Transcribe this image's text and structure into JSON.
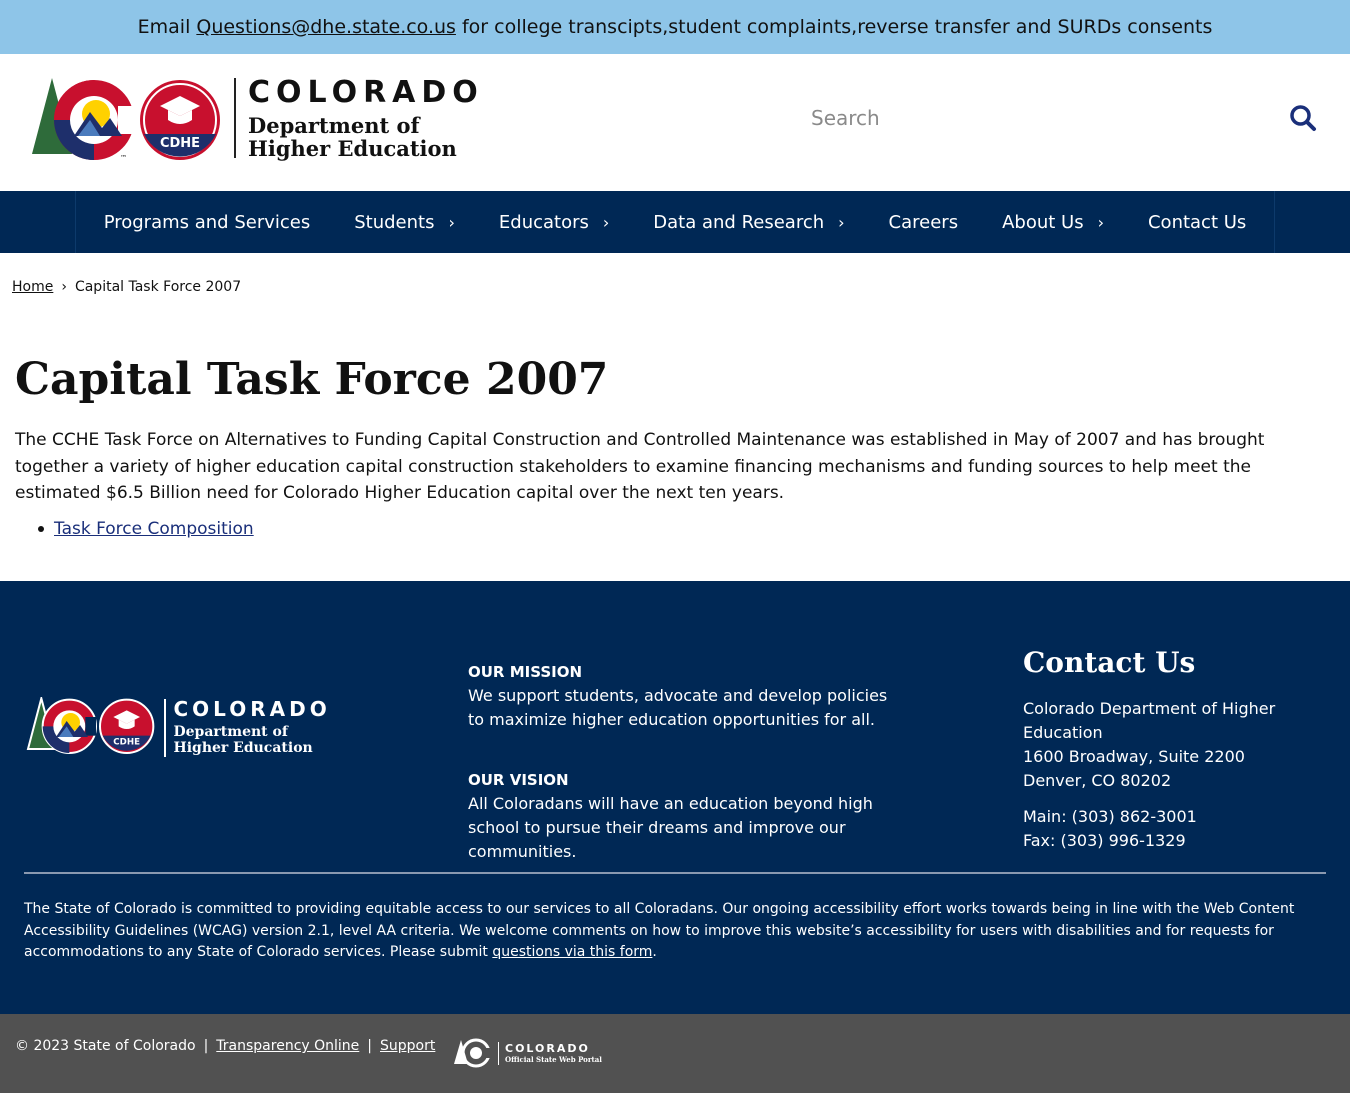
{
  "alert": {
    "prefix": "Email",
    "email": "Questions@dhe.state.co.us",
    "suffix": "for college transcipts,student complaints,reverse transfer and SURDs consents"
  },
  "header": {
    "logo_title": "COLORADO",
    "logo_sub_line1": "Department of",
    "logo_sub_line2": "Higher Education",
    "badge_text": "CDHE",
    "tm_mark": "™",
    "search_placeholder": "Search",
    "search_icon": "search-icon"
  },
  "nav": {
    "items": [
      {
        "label": "Programs and Services",
        "has_submenu": false
      },
      {
        "label": "Students",
        "has_submenu": true
      },
      {
        "label": "Educators",
        "has_submenu": true
      },
      {
        "label": "Data and Research",
        "has_submenu": true
      },
      {
        "label": "Careers",
        "has_submenu": false
      },
      {
        "label": "About Us",
        "has_submenu": true
      },
      {
        "label": "Contact Us",
        "has_submenu": false
      }
    ],
    "caret": "›"
  },
  "breadcrumb": {
    "home": "Home",
    "separator": "›",
    "current": "Capital Task Force 2007"
  },
  "main": {
    "title": "Capital Task Force 2007",
    "intro": "The CCHE Task Force on Alternatives to Funding Capital Construction and Controlled Maintenance was established in May of 2007 and has brought together a variety of higher education capital construction stakeholders to examine financing mechanisms and funding sources to help meet the estimated $6.5 Billion need for Colorado Higher Education capital over the next ten years.",
    "links": [
      "Task Force Composition"
    ]
  },
  "footer": {
    "logo_title": "COLORADO",
    "logo_sub_line1": "Department of",
    "logo_sub_line2": "Higher Education",
    "mission_heading": "OUR MISSION",
    "mission_text": "We support students, advocate and develop policies to maximize higher education opportunities for all.",
    "vision_heading": "OUR VISION",
    "vision_text": "All Coloradans will have an education beyond high school to pursue their dreams and improve our communities.",
    "contact_heading": "Contact Us",
    "contact_org": "Colorado Department of Higher Education",
    "contact_street": "1600 Broadway, Suite 2200",
    "contact_city": "Denver, CO 80202",
    "contact_main": "Main: (303) 862-3001",
    "contact_fax": "Fax: (303) 996-1329",
    "access_text_before": "The State of Colorado is committed to providing equitable access to our services to all Coloradans. Our ongoing accessibility effort works towards being in line with the Web Content Accessibility Guidelines (WCAG) version 2.1, level AA criteria. We welcome comments on how to improve this website’s accessibility for users with disabilities and for requests for accommodations to any State of Colorado services. Please submit ",
    "access_link": "questions via this form",
    "access_text_after": "."
  },
  "bottom": {
    "copyright": "© 2023 State of Colorado",
    "pipe": "|",
    "transparency": "Transparency Online",
    "support": "Support",
    "portal_title": "COLORADO",
    "portal_sub": "Official State Web Portal"
  },
  "colors": {
    "alert_bg": "#8ec5e8",
    "navy": "#002855",
    "bottom_bg": "#515151",
    "link_blue": "#1a2f7a",
    "logo_red": "#c8102e",
    "logo_gold": "#ffd100",
    "logo_green": "#2e6b3a"
  }
}
